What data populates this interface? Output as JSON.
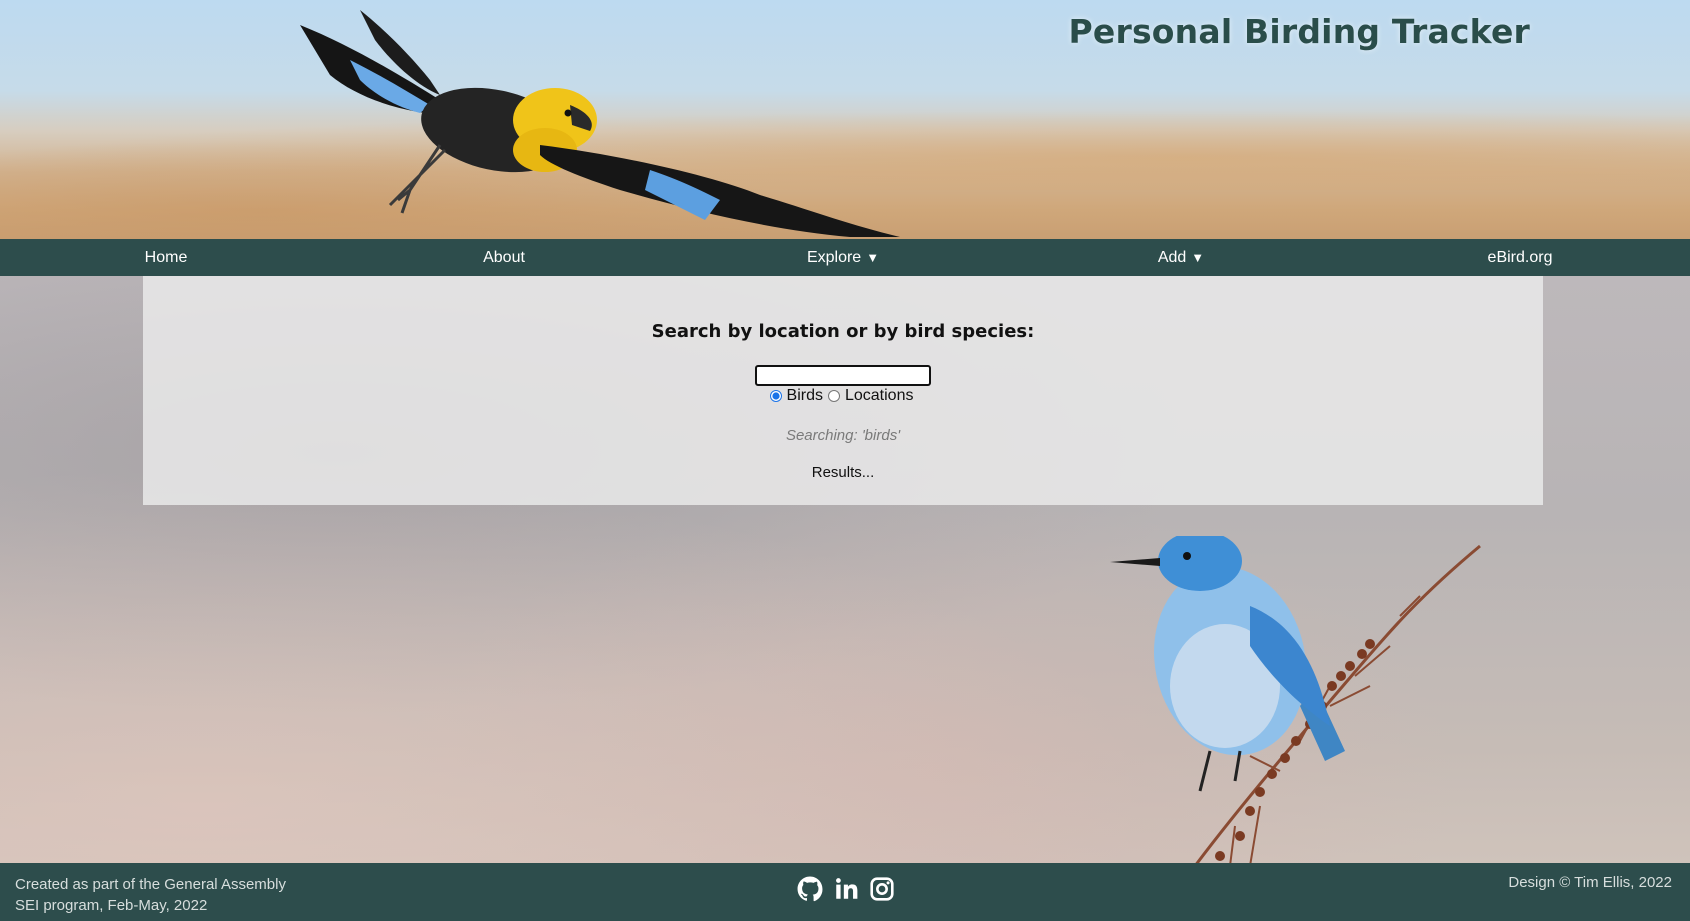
{
  "header": {
    "title": "Personal Birding Tracker"
  },
  "nav": {
    "items": [
      {
        "label": "Home"
      },
      {
        "label": "About"
      },
      {
        "label": "Explore",
        "icon": "caret-down-icon"
      },
      {
        "label": "Add",
        "icon": "caret-down-icon"
      },
      {
        "label": "eBird.org"
      }
    ],
    "caret": "▼"
  },
  "search": {
    "heading": "Search by location or by bird species:",
    "input_value": "",
    "options": [
      {
        "label": "Birds",
        "checked": true
      },
      {
        "label": "Locations",
        "checked": false
      }
    ],
    "status": "Searching: 'birds'",
    "results": "Results..."
  },
  "footer": {
    "credit_line1": "Created as part of the General Assembly",
    "credit_line2": "SEI program, Feb-May, 2022",
    "social_icons": [
      "github-icon",
      "linkedin-icon",
      "instagram-icon"
    ],
    "copyright": "Design © Tim Ellis, 2022"
  },
  "colors": {
    "nav_bg": "#2d4d4c",
    "title": "#2a4d4a",
    "footer_text": "#d7dedd"
  }
}
